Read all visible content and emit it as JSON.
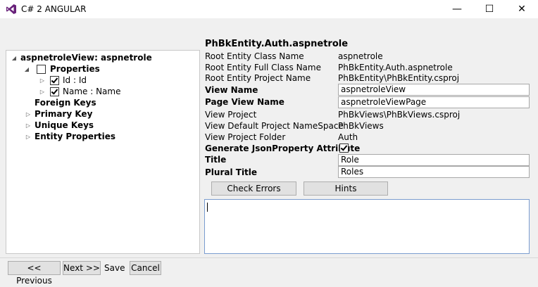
{
  "window": {
    "title": "C# 2 ANGULAR",
    "minimize": "—",
    "maximize": "☐",
    "close": "✕"
  },
  "tree": {
    "root": "aspnetroleView: aspnetrole",
    "properties": "Properties",
    "prop_id": "Id : Id",
    "prop_name": "Name : Name",
    "foreign_keys": "Foreign Keys",
    "primary_key": "Primary Key",
    "unique_keys": "Unique Keys",
    "entity_properties": "Entity Properties"
  },
  "details": {
    "header": "PhBkEntity.Auth.aspnetrole",
    "rows": {
      "class_name_label": "Root Entity Class Name",
      "class_name_value": "aspnetrole",
      "full_class_label": "Root Entity Full Class Name",
      "full_class_value": "PhBkEntity.Auth.aspnetrole",
      "project_name_label": "Root Entity Project Name",
      "project_name_value": "PhBkEntity\\PhBkEntity.csproj",
      "view_name_label": "View Name",
      "view_name_value": "aspnetroleView",
      "page_view_label": "Page View Name",
      "page_view_value": "aspnetroleViewPage",
      "view_project_label": "View Project",
      "view_project_value": "PhBkViews\\PhBkViews.csproj",
      "namespace_label": "View Default Project NameSpace",
      "namespace_value": "PhBkViews",
      "folder_label": "View Project Folder",
      "folder_value": "Auth",
      "json_label": "Generate JsonProperty Attribute",
      "title_label": "Title",
      "title_value": "Role",
      "plural_label": "Plural Title",
      "plural_value": "Roles"
    },
    "check_errors": "Check Errors",
    "hints": "Hints",
    "output": ""
  },
  "footer": {
    "previous": "<< Previous",
    "next": "Next >>",
    "save": "Save",
    "cancel": "Cancel"
  },
  "colors": {
    "vs_purple": "#68217a",
    "focus_border": "#7a9ccf"
  }
}
